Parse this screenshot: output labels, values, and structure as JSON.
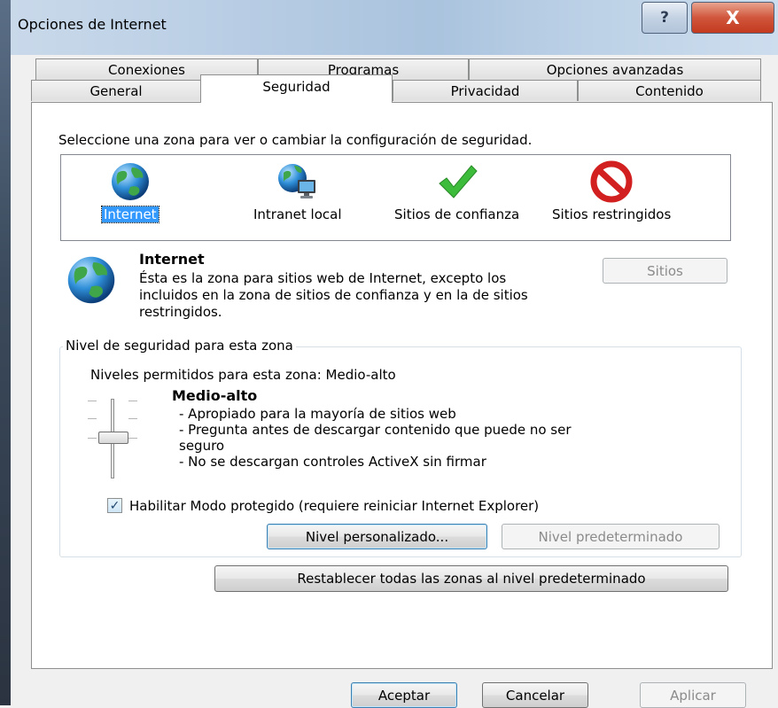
{
  "window": {
    "title": "Opciones de Internet",
    "help_label": "?",
    "close_label": "X"
  },
  "tabs": {
    "row_back": [
      "Conexiones",
      "Programas",
      "Opciones avanzadas"
    ],
    "row_front": [
      "General",
      "Seguridad",
      "Privacidad",
      "Contenido"
    ],
    "selected": "Seguridad"
  },
  "security": {
    "instruction": "Seleccione una zona para ver o cambiar la configuración de seguridad.",
    "zones": [
      {
        "label": "Internet",
        "icon": "globe-icon",
        "selected": true
      },
      {
        "label": "Intranet local",
        "icon": "intranet-icon",
        "selected": false
      },
      {
        "label": "Sitios de confianza",
        "icon": "checkmark-icon",
        "selected": false
      },
      {
        "label": "Sitios restringidos",
        "icon": "prohibited-icon",
        "selected": false
      }
    ],
    "zone_title": "Internet",
    "zone_description": "Ésta es la zona para sitios web de Internet, excepto los incluidos en la zona de sitios de confianza y en la de sitios restringidos.",
    "sites_button": "Sitios",
    "group_legend": "Nivel de seguridad para esta zona",
    "allowed_levels": "Niveles permitidos para esta zona: Medio-alto",
    "level_name": "Medio-alto",
    "level_lines": [
      "- Apropiado para la mayoría de sitios web",
      "- Pregunta antes de descargar contenido que puede no ser",
      "seguro",
      "- No se descargan controles ActiveX sin firmar"
    ],
    "protected_mode_label": "Habilitar Modo protegido (requiere reiniciar Internet Explorer)",
    "protected_mode_checked": true,
    "custom_level_button": "Nivel personalizado...",
    "default_level_button": "Nivel predeterminado",
    "reset_all_button": "Restablecer todas las zonas al nivel predeterminado"
  },
  "footer": {
    "ok_button": "Aceptar",
    "cancel_button": "Cancelar",
    "apply_button": "Aplicar"
  },
  "colors": {
    "selection": "#3399ff",
    "close_button": "#c33a1f"
  }
}
